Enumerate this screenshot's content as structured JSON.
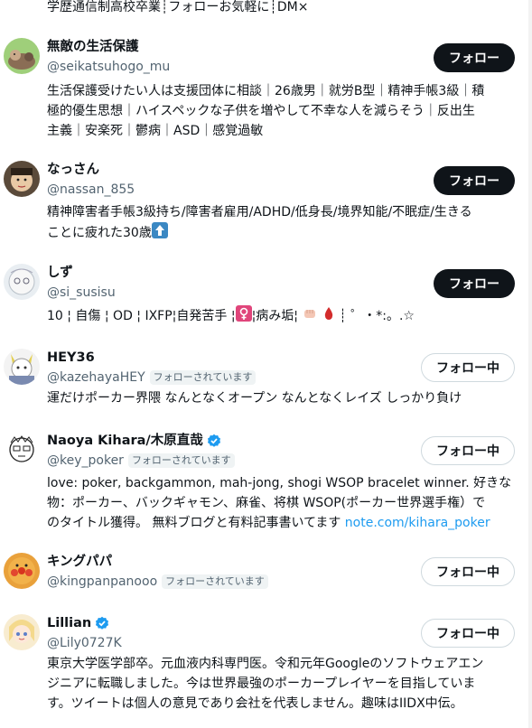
{
  "top_text": "学歴通信制高校卒業┊フォローお気軽に┊DM×",
  "buttons": {
    "follow": "フォロー",
    "following": "フォロー中"
  },
  "follows_you": "フォローされています",
  "users": [
    {
      "name": "無敵の生活保護",
      "handle": "@seikatsuhogo_mu",
      "bio": [
        "生活保護受けたい人は支援団体に相談｜26歳男｜就労B型｜精神手帳3級｜積",
        "極的優生思想｜ハイスペックな子供を増やして不幸な人を減らそう｜反出生",
        "主義｜安楽死｜鬱病｜ASD｜感覚過敏"
      ]
    },
    {
      "name": "なっさん",
      "handle": "@nassan_855",
      "bio": [
        "精神障害者手帳3級持ち/障害者雇用/ADHD/低身長/境界知能/不眠症/生きる",
        "ことに疲れた30歳"
      ]
    },
    {
      "name": "しず",
      "handle": "@si_susisu",
      "bio": [
        "10 ¦ 自傷 ¦ OD ¦ IXFP¦自発苦手 ¦",
        "¦病み垢¦",
        "┊ ゜・*:。.☆"
      ]
    },
    {
      "name": "HEY36",
      "handle": "@kazehayaHEY",
      "bio": [
        "運だけポーカー界隈 なんとなくオープン なんとなくレイズ しっかり負け"
      ]
    },
    {
      "name": "Naoya Kihara/木原直哉",
      "handle": "@key_poker",
      "bio": [
        "love: poker, backgammon, mah-jong, shogi WSOP bracelet winner. 好きな",
        "物：ポーカー、バックギャモン、麻雀、将棋 WSOP(ポーカー世界選手権）で",
        "のタイトル獲得。 無料ブログと有料記事書いてます "
      ],
      "link": "note.com/kihara_poker"
    },
    {
      "name": "キングパパ",
      "handle": "@kingpanpanooo",
      "bio": []
    },
    {
      "name": "Lillian",
      "handle": "@Lily0727K",
      "bio": [
        "東京大学医学部卒。元血液内科専門医。令和元年Googleのソフトウェアエン",
        "ジニアに転職しました。今は世界最強のポーカープレイヤーを目指していま",
        "す。ツイートは個人の意見であり会社を代表しません。趣味はIIDX中伝。"
      ]
    }
  ]
}
